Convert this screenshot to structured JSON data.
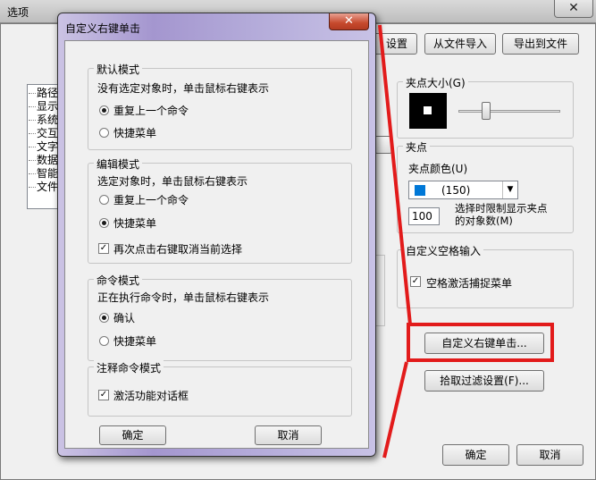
{
  "outer": {
    "title": "选项",
    "close_glyph": "✕",
    "buttons": {
      "settings_partial": "设置",
      "import": "从文件导入",
      "export": "导出到文件",
      "custom_right_click": "自定义右键单击...",
      "pick_filter": "拾取过滤设置(F)...",
      "ok": "确定",
      "cancel": "取消"
    },
    "tree_items": [
      "路径",
      "显示",
      "系统",
      "交互",
      "文字",
      "数据",
      "智能",
      "文件"
    ],
    "grip_size": {
      "title": "夹点大小(G)",
      "slider_fraction": 0.27
    },
    "grips": {
      "title": "夹点",
      "color_label": "夹点颜色(U)",
      "color_value": "(150)",
      "color_swatch": "#0078d7",
      "limit_value": "100",
      "limit_text_line1": "选择时限制显示夹点",
      "limit_text_line2": "的对象数(M)"
    },
    "custom_space": {
      "title": "自定义空格输入",
      "checkbox_label": "空格激活捕捉菜单",
      "checked": true
    }
  },
  "dialog": {
    "title": "自定义右键单击",
    "close_glyph": "✕",
    "default_mode": {
      "title": "默认模式",
      "desc": "没有选定对象时，单击鼠标右键表示",
      "option1": "重复上一个命令",
      "option2": "快捷菜单",
      "selected": 1
    },
    "edit_mode": {
      "title": "编辑模式",
      "desc": "选定对象时，单击鼠标右键表示",
      "option1": "重复上一个命令",
      "option2": "快捷菜单",
      "selected": 2,
      "checkbox_label": "再次点击右键取消当前选择",
      "checked": true
    },
    "command_mode": {
      "title": "命令模式",
      "desc": "正在执行命令时，单击鼠标右键表示",
      "option1": "确认",
      "option2": "快捷菜单",
      "selected": 1
    },
    "annotation_mode": {
      "title": "注释命令模式",
      "checkbox_label": "激活功能对话框",
      "checked": true
    },
    "ok": "确定",
    "cancel": "取消"
  },
  "colors": {
    "annotation_red": "#e21b1b",
    "dialog_frame": "#a496cf"
  }
}
